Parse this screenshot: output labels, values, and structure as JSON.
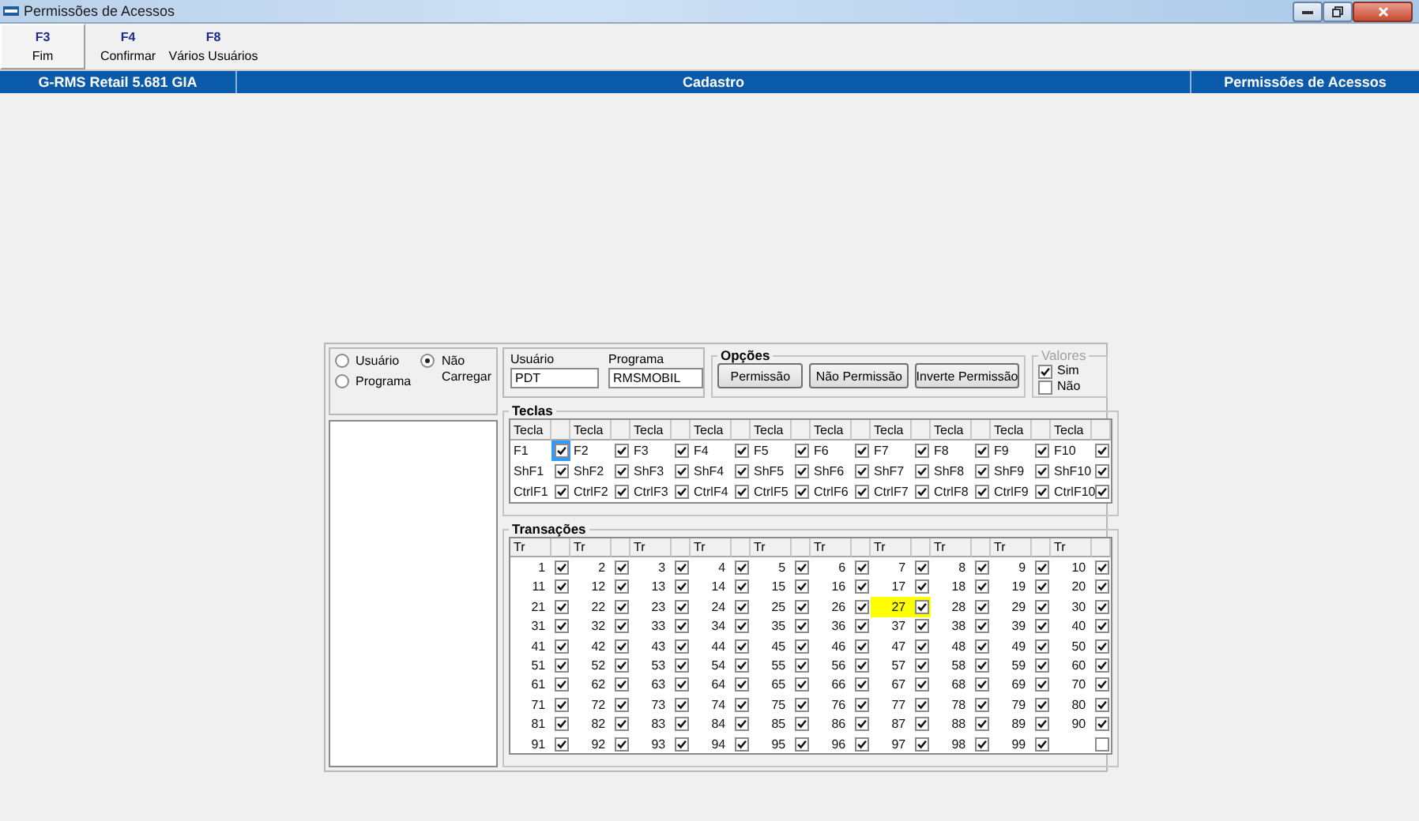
{
  "window": {
    "title": "Permissões de Acessos"
  },
  "toolbar": [
    {
      "key": "F3",
      "label": "Fim",
      "selected": true
    },
    {
      "key": "F4",
      "label": "Confirmar",
      "selected": false
    },
    {
      "key": "F8",
      "label": "Vários Usuários",
      "selected": false
    }
  ],
  "banner": [
    "G-RMS Retail 5.681 GIA",
    "Cadastro",
    "Permissões de Acessos"
  ],
  "mode_options": [
    {
      "label": "Usuário",
      "selected": false
    },
    {
      "label": "Programa",
      "selected": false
    },
    {
      "label": "Não Carregar",
      "selected": true
    }
  ],
  "fields": [
    {
      "label": "Usuário",
      "value": "PDT"
    },
    {
      "label": "Programa",
      "value": "RMSMOBIL"
    }
  ],
  "opcoes": {
    "title": "Opções",
    "buttons": [
      "Permissão",
      "Não Permissão",
      "Inverte Permissão"
    ]
  },
  "valores": {
    "title": "Valores",
    "disabled": true,
    "options": [
      {
        "label": "Sim",
        "checked": true
      },
      {
        "label": "Não",
        "checked": false
      }
    ]
  },
  "teclas": {
    "title": "Teclas",
    "columns": [
      "Tecla",
      "Tecla",
      "Tecla",
      "Tecla",
      "Tecla",
      "Tecla",
      "Tecla",
      "Tecla",
      "Tecla",
      "Tecla"
    ],
    "rows": [
      [
        {
          "key": "F1",
          "checked": true,
          "selected": true
        },
        {
          "key": "F2",
          "checked": true,
          "selected": false
        },
        {
          "key": "F3",
          "checked": true,
          "selected": false
        },
        {
          "key": "F4",
          "checked": true,
          "selected": false
        },
        {
          "key": "F5",
          "checked": true,
          "selected": false
        },
        {
          "key": "F6",
          "checked": true,
          "selected": false
        },
        {
          "key": "F7",
          "checked": true,
          "selected": false
        },
        {
          "key": "F8",
          "checked": true,
          "selected": false
        },
        {
          "key": "F9",
          "checked": true,
          "selected": false
        },
        {
          "key": "F10",
          "checked": true,
          "selected": false
        }
      ],
      [
        {
          "key": "ShF1",
          "checked": true,
          "selected": false
        },
        {
          "key": "ShF2",
          "checked": true,
          "selected": false
        },
        {
          "key": "ShF3",
          "checked": true,
          "selected": false
        },
        {
          "key": "ShF4",
          "checked": true,
          "selected": false
        },
        {
          "key": "ShF5",
          "checked": true,
          "selected": false
        },
        {
          "key": "ShF6",
          "checked": true,
          "selected": false
        },
        {
          "key": "ShF7",
          "checked": true,
          "selected": false
        },
        {
          "key": "ShF8",
          "checked": true,
          "selected": false
        },
        {
          "key": "ShF9",
          "checked": true,
          "selected": false
        },
        {
          "key": "ShF10",
          "checked": true,
          "selected": false
        }
      ],
      [
        {
          "key": "CtrlF1",
          "checked": true,
          "selected": false
        },
        {
          "key": "CtrlF2",
          "checked": true,
          "selected": false
        },
        {
          "key": "CtrlF3",
          "checked": true,
          "selected": false
        },
        {
          "key": "CtrlF4",
          "checked": true,
          "selected": false
        },
        {
          "key": "CtrlF5",
          "checked": true,
          "selected": false
        },
        {
          "key": "CtrlF6",
          "checked": true,
          "selected": false
        },
        {
          "key": "CtrlF7",
          "checked": true,
          "selected": false
        },
        {
          "key": "CtrlF8",
          "checked": true,
          "selected": false
        },
        {
          "key": "CtrlF9",
          "checked": true,
          "selected": false
        },
        {
          "key": "CtrlF10",
          "checked": true,
          "selected": false
        }
      ]
    ]
  },
  "transacoes": {
    "title": "Transações",
    "columns": [
      "Tr",
      "Tr",
      "Tr",
      "Tr",
      "Tr",
      "Tr",
      "Tr",
      "Tr",
      "Tr",
      "Tr"
    ],
    "rows": [
      [
        {
          "tr": "1",
          "checked": true,
          "selected": false
        },
        {
          "tr": "2",
          "checked": true,
          "selected": false
        },
        {
          "tr": "3",
          "checked": true,
          "selected": false
        },
        {
          "tr": "4",
          "checked": true,
          "selected": false
        },
        {
          "tr": "5",
          "checked": true,
          "selected": false
        },
        {
          "tr": "6",
          "checked": true,
          "selected": false
        },
        {
          "tr": "7",
          "checked": true,
          "selected": false
        },
        {
          "tr": "8",
          "checked": true,
          "selected": false
        },
        {
          "tr": "9",
          "checked": true,
          "selected": false
        },
        {
          "tr": "10",
          "checked": true,
          "selected": false
        }
      ],
      [
        {
          "tr": "11",
          "checked": true,
          "selected": false
        },
        {
          "tr": "12",
          "checked": true,
          "selected": false
        },
        {
          "tr": "13",
          "checked": true,
          "selected": false
        },
        {
          "tr": "14",
          "checked": true,
          "selected": false
        },
        {
          "tr": "15",
          "checked": true,
          "selected": false
        },
        {
          "tr": "16",
          "checked": true,
          "selected": false
        },
        {
          "tr": "17",
          "checked": true,
          "selected": false
        },
        {
          "tr": "18",
          "checked": true,
          "selected": false
        },
        {
          "tr": "19",
          "checked": true,
          "selected": false
        },
        {
          "tr": "20",
          "checked": true,
          "selected": false
        }
      ],
      [
        {
          "tr": "21",
          "checked": true,
          "selected": false
        },
        {
          "tr": "22",
          "checked": true,
          "selected": false
        },
        {
          "tr": "23",
          "checked": true,
          "selected": false
        },
        {
          "tr": "24",
          "checked": true,
          "selected": false
        },
        {
          "tr": "25",
          "checked": true,
          "selected": false
        },
        {
          "tr": "26",
          "checked": true,
          "selected": false
        },
        {
          "tr": "27",
          "checked": true,
          "selected": true
        },
        {
          "tr": "28",
          "checked": true,
          "selected": false
        },
        {
          "tr": "29",
          "checked": true,
          "selected": false
        },
        {
          "tr": "30",
          "checked": true,
          "selected": false
        }
      ],
      [
        {
          "tr": "31",
          "checked": true,
          "selected": false
        },
        {
          "tr": "32",
          "checked": true,
          "selected": false
        },
        {
          "tr": "33",
          "checked": true,
          "selected": false
        },
        {
          "tr": "34",
          "checked": true,
          "selected": false
        },
        {
          "tr": "35",
          "checked": true,
          "selected": false
        },
        {
          "tr": "36",
          "checked": true,
          "selected": false
        },
        {
          "tr": "37",
          "checked": true,
          "selected": false
        },
        {
          "tr": "38",
          "checked": true,
          "selected": false
        },
        {
          "tr": "39",
          "checked": true,
          "selected": false
        },
        {
          "tr": "40",
          "checked": true,
          "selected": false
        }
      ],
      [
        {
          "tr": "41",
          "checked": true,
          "selected": false
        },
        {
          "tr": "42",
          "checked": true,
          "selected": false
        },
        {
          "tr": "43",
          "checked": true,
          "selected": false
        },
        {
          "tr": "44",
          "checked": true,
          "selected": false
        },
        {
          "tr": "45",
          "checked": true,
          "selected": false
        },
        {
          "tr": "46",
          "checked": true,
          "selected": false
        },
        {
          "tr": "47",
          "checked": true,
          "selected": false
        },
        {
          "tr": "48",
          "checked": true,
          "selected": false
        },
        {
          "tr": "49",
          "checked": true,
          "selected": false
        },
        {
          "tr": "50",
          "checked": true,
          "selected": false
        }
      ],
      [
        {
          "tr": "51",
          "checked": true,
          "selected": false
        },
        {
          "tr": "52",
          "checked": true,
          "selected": false
        },
        {
          "tr": "53",
          "checked": true,
          "selected": false
        },
        {
          "tr": "54",
          "checked": true,
          "selected": false
        },
        {
          "tr": "55",
          "checked": true,
          "selected": false
        },
        {
          "tr": "56",
          "checked": true,
          "selected": false
        },
        {
          "tr": "57",
          "checked": true,
          "selected": false
        },
        {
          "tr": "58",
          "checked": true,
          "selected": false
        },
        {
          "tr": "59",
          "checked": true,
          "selected": false
        },
        {
          "tr": "60",
          "checked": true,
          "selected": false
        }
      ],
      [
        {
          "tr": "61",
          "checked": true,
          "selected": false
        },
        {
          "tr": "62",
          "checked": true,
          "selected": false
        },
        {
          "tr": "63",
          "checked": true,
          "selected": false
        },
        {
          "tr": "64",
          "checked": true,
          "selected": false
        },
        {
          "tr": "65",
          "checked": true,
          "selected": false
        },
        {
          "tr": "66",
          "checked": true,
          "selected": false
        },
        {
          "tr": "67",
          "checked": true,
          "selected": false
        },
        {
          "tr": "68",
          "checked": true,
          "selected": false
        },
        {
          "tr": "69",
          "checked": true,
          "selected": false
        },
        {
          "tr": "70",
          "checked": true,
          "selected": false
        }
      ],
      [
        {
          "tr": "71",
          "checked": true,
          "selected": false
        },
        {
          "tr": "72",
          "checked": true,
          "selected": false
        },
        {
          "tr": "73",
          "checked": true,
          "selected": false
        },
        {
          "tr": "74",
          "checked": true,
          "selected": false
        },
        {
          "tr": "75",
          "checked": true,
          "selected": false
        },
        {
          "tr": "76",
          "checked": true,
          "selected": false
        },
        {
          "tr": "77",
          "checked": true,
          "selected": false
        },
        {
          "tr": "78",
          "checked": true,
          "selected": false
        },
        {
          "tr": "79",
          "checked": true,
          "selected": false
        },
        {
          "tr": "80",
          "checked": true,
          "selected": false
        }
      ],
      [
        {
          "tr": "81",
          "checked": true,
          "selected": false
        },
        {
          "tr": "82",
          "checked": true,
          "selected": false
        },
        {
          "tr": "83",
          "checked": true,
          "selected": false
        },
        {
          "tr": "84",
          "checked": true,
          "selected": false
        },
        {
          "tr": "85",
          "checked": true,
          "selected": false
        },
        {
          "tr": "86",
          "checked": true,
          "selected": false
        },
        {
          "tr": "87",
          "checked": true,
          "selected": false
        },
        {
          "tr": "88",
          "checked": true,
          "selected": false
        },
        {
          "tr": "89",
          "checked": true,
          "selected": false
        },
        {
          "tr": "90",
          "checked": true,
          "selected": false
        }
      ],
      [
        {
          "tr": "91",
          "checked": true,
          "selected": false
        },
        {
          "tr": "92",
          "checked": true,
          "selected": false
        },
        {
          "tr": "93",
          "checked": true,
          "selected": false
        },
        {
          "tr": "94",
          "checked": true,
          "selected": false
        },
        {
          "tr": "95",
          "checked": true,
          "selected": false
        },
        {
          "tr": "96",
          "checked": true,
          "selected": false
        },
        {
          "tr": "97",
          "checked": true,
          "selected": false
        },
        {
          "tr": "98",
          "checked": true,
          "selected": false
        },
        {
          "tr": "99",
          "checked": true,
          "selected": false
        },
        {
          "checked": false,
          "selected": false
        }
      ]
    ]
  }
}
